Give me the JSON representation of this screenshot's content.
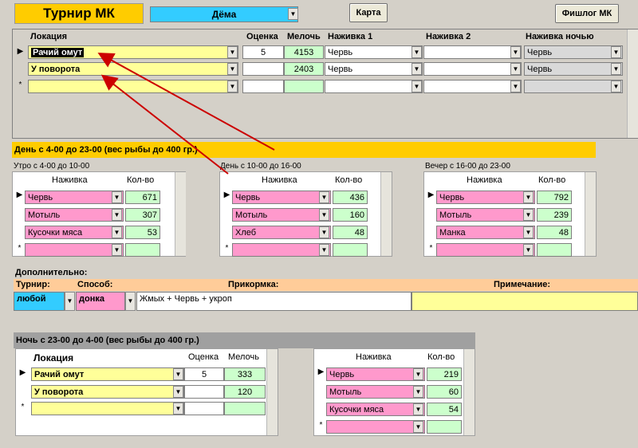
{
  "header": {
    "title": "Турнир МК",
    "user": "Дёма",
    "map_button": "Карта",
    "fishlog_button": "Фишлог МК"
  },
  "locations": {
    "headers": {
      "location": "Локация",
      "score": "Оценка",
      "small": "Мелочь",
      "bait1": "Наживка 1",
      "bait2": "Наживка 2",
      "bait_night": "Наживка ночью"
    },
    "rows": [
      {
        "location": "Рачий омут",
        "score": "5",
        "small": "4153",
        "bait1": "Червь",
        "bait2": "",
        "bait_night": "Червь"
      },
      {
        "location": "У поворота",
        "score": "",
        "small": "2403",
        "bait1": "Червь",
        "bait2": "",
        "bait_night": "Червь"
      }
    ],
    "new_marker": "*"
  },
  "day": {
    "title": "День  с 4-00 до 23-00  (вес рыбы до 400 гр.)",
    "bait_header": "Наживка",
    "count_header": "Кол-во",
    "morning": {
      "title": "Утро с 4-00 до 10-00",
      "rows": [
        {
          "bait": "Червь",
          "count": "671"
        },
        {
          "bait": "Мотыль",
          "count": "307"
        },
        {
          "bait": "Кусочки мяса",
          "count": "53"
        }
      ]
    },
    "midday": {
      "title": "День с 10-00 до 16-00",
      "rows": [
        {
          "bait": "Червь",
          "count": "436"
        },
        {
          "bait": "Мотыль",
          "count": "160"
        },
        {
          "bait": "Хлеб",
          "count": "48"
        }
      ]
    },
    "evening": {
      "title": "Вечер с 16-00 до 23-00",
      "rows": [
        {
          "bait": "Червь",
          "count": "792"
        },
        {
          "bait": "Мотыль",
          "count": "239"
        },
        {
          "bait": "Манка",
          "count": "48"
        }
      ]
    }
  },
  "extra": {
    "title": "Дополнительно:",
    "tournament_label": "Турнир:",
    "method_label": "Способ:",
    "groundbait_label": "Прикормка:",
    "note_label": "Примечание:",
    "tournament": "любой",
    "method": "донка",
    "groundbait": "Жмых + Червь + укроп",
    "note": ""
  },
  "night": {
    "title": "Ночь  с 23-00 до 4-00  (вес рыбы до 400 гр.)",
    "headers": {
      "location": "Локация",
      "score": "Оценка",
      "small": "Мелочь",
      "bait": "Наживка",
      "count": "Кол-во"
    },
    "locations": [
      {
        "location": "Рачий омут",
        "score": "5",
        "small": "333"
      },
      {
        "location": "У поворота",
        "score": "",
        "small": "120"
      }
    ],
    "baits": [
      {
        "bait": "Червь",
        "count": "219"
      },
      {
        "bait": "Мотыль",
        "count": "60"
      },
      {
        "bait": "Кусочки мяса",
        "count": "54"
      }
    ]
  },
  "colors": {
    "accent_orange": "#ffcc00",
    "yellow": "#ffff99",
    "pink": "#ff99cc",
    "green": "#ccffcc",
    "cyan": "#33ccff",
    "arrow": "#cc0000"
  }
}
